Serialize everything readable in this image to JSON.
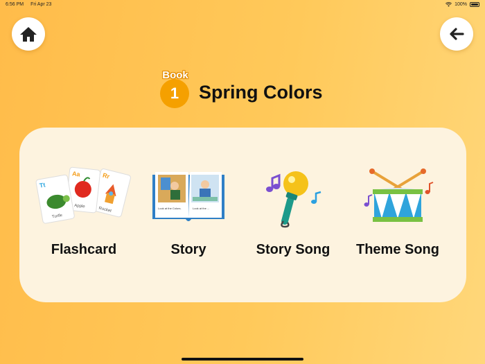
{
  "status_bar": {
    "time": "6:56 PM",
    "date": "Fri Apr 23",
    "battery": "100%"
  },
  "nav": {
    "home_icon": "home-icon",
    "back_icon": "back-arrow-icon"
  },
  "header": {
    "book_label": "Book",
    "book_number": "1",
    "title": "Spring Colors"
  },
  "menu": {
    "items": [
      {
        "label": "Flashcard",
        "icon": "flashcard-icon",
        "card_letters": [
          "Tt",
          "Aa",
          "Rr"
        ],
        "card_words": [
          "Turtle",
          "Apple",
          "Rocket"
        ]
      },
      {
        "label": "Story",
        "icon": "storybook-icon",
        "page_captions": [
          "Look at the Colors.",
          "Look at the ..."
        ]
      },
      {
        "label": "Story Song",
        "icon": "microphone-icon"
      },
      {
        "label": "Theme Song",
        "icon": "drum-icon"
      }
    ]
  },
  "colors": {
    "accent": "#f5a000",
    "panel": "#fdf3df",
    "background": "#ffc451"
  }
}
